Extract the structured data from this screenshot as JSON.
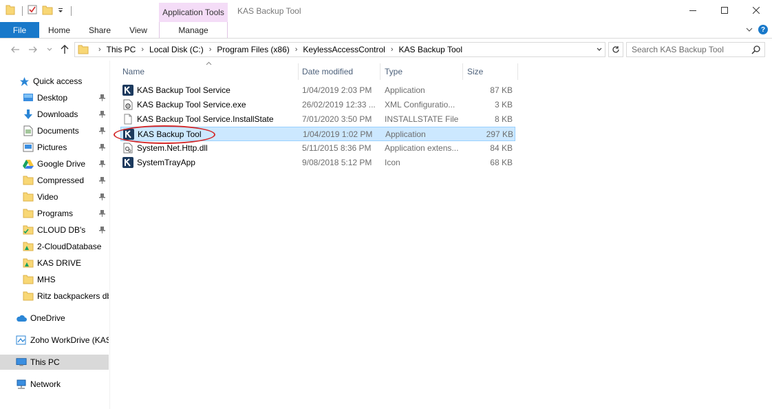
{
  "window": {
    "title": "KAS Backup Tool",
    "context_tab": "Application Tools"
  },
  "ribbon": {
    "tabs": [
      {
        "label": "File"
      },
      {
        "label": "Home"
      },
      {
        "label": "Share"
      },
      {
        "label": "View"
      },
      {
        "label": "Manage"
      }
    ]
  },
  "address": {
    "breadcrumbs": [
      "This PC",
      "Local Disk (C:)",
      "Program Files (x86)",
      "KeylessAccessControl",
      "KAS Backup Tool"
    ],
    "search_placeholder": "Search KAS Backup Tool"
  },
  "sidebar": {
    "items": [
      {
        "label": "Quick access",
        "icon": "star-icon",
        "pinned": false
      },
      {
        "label": "Desktop",
        "icon": "desktop-icon",
        "pinned": true
      },
      {
        "label": "Downloads",
        "icon": "download-arrow-icon",
        "pinned": true
      },
      {
        "label": "Documents",
        "icon": "document-icon",
        "pinned": true
      },
      {
        "label": "Pictures",
        "icon": "pictures-icon",
        "pinned": true
      },
      {
        "label": "Google Drive",
        "icon": "google-drive-icon",
        "pinned": true
      },
      {
        "label": "Compressed",
        "icon": "folder-icon",
        "pinned": true
      },
      {
        "label": "Video",
        "icon": "folder-icon",
        "pinned": true
      },
      {
        "label": "Programs",
        "icon": "folder-icon",
        "pinned": true
      },
      {
        "label": "CLOUD DB's",
        "icon": "folder-check-icon",
        "pinned": true
      },
      {
        "label": "2-CloudDatabase",
        "icon": "drive-folder-icon",
        "pinned": false
      },
      {
        "label": "KAS DRIVE",
        "icon": "drive-folder-icon",
        "pinned": false
      },
      {
        "label": "MHS",
        "icon": "folder-icon",
        "pinned": false
      },
      {
        "label": "Ritz backpackers db",
        "icon": "folder-icon",
        "pinned": false
      },
      {
        "label": "OneDrive",
        "icon": "cloud-icon",
        "pinned": false
      },
      {
        "label": "Zoho WorkDrive (KAS",
        "icon": "zoho-drive-icon",
        "pinned": false
      },
      {
        "label": "This PC",
        "icon": "computer-icon",
        "pinned": false
      },
      {
        "label": "Network",
        "icon": "network-icon",
        "pinned": false
      }
    ]
  },
  "columns": [
    "Name",
    "Date modified",
    "Type",
    "Size"
  ],
  "files": [
    {
      "name": "KAS Backup Tool Service",
      "date": "1/04/2019 2:03 PM",
      "type": "Application",
      "size": "87 KB",
      "icon": "kas-app-icon"
    },
    {
      "name": "KAS Backup Tool Service.exe",
      "date": "26/02/2019 12:33 ...",
      "type": "XML Configuratio...",
      "size": "3 KB",
      "icon": "config-file-icon"
    },
    {
      "name": "KAS Backup Tool Service.InstallState",
      "date": "7/01/2020 3:50 PM",
      "type": "INSTALLSTATE File",
      "size": "8 KB",
      "icon": "blank-file-icon"
    },
    {
      "name": "KAS Backup Tool",
      "date": "1/04/2019 1:02 PM",
      "type": "Application",
      "size": "297 KB",
      "icon": "kas-app-icon"
    },
    {
      "name": "System.Net.Http.dll",
      "date": "5/11/2015 8:36 PM",
      "type": "Application extens...",
      "size": "84 KB",
      "icon": "dll-file-icon"
    },
    {
      "name": "SystemTrayApp",
      "date": "9/08/2018 5:12 PM",
      "type": "Icon",
      "size": "68 KB",
      "icon": "kas-app-icon"
    }
  ],
  "selected_file_index": 3,
  "colors": {
    "accent": "#1979ca",
    "selection": "#cce8ff",
    "annotation": "#d42a2a"
  }
}
